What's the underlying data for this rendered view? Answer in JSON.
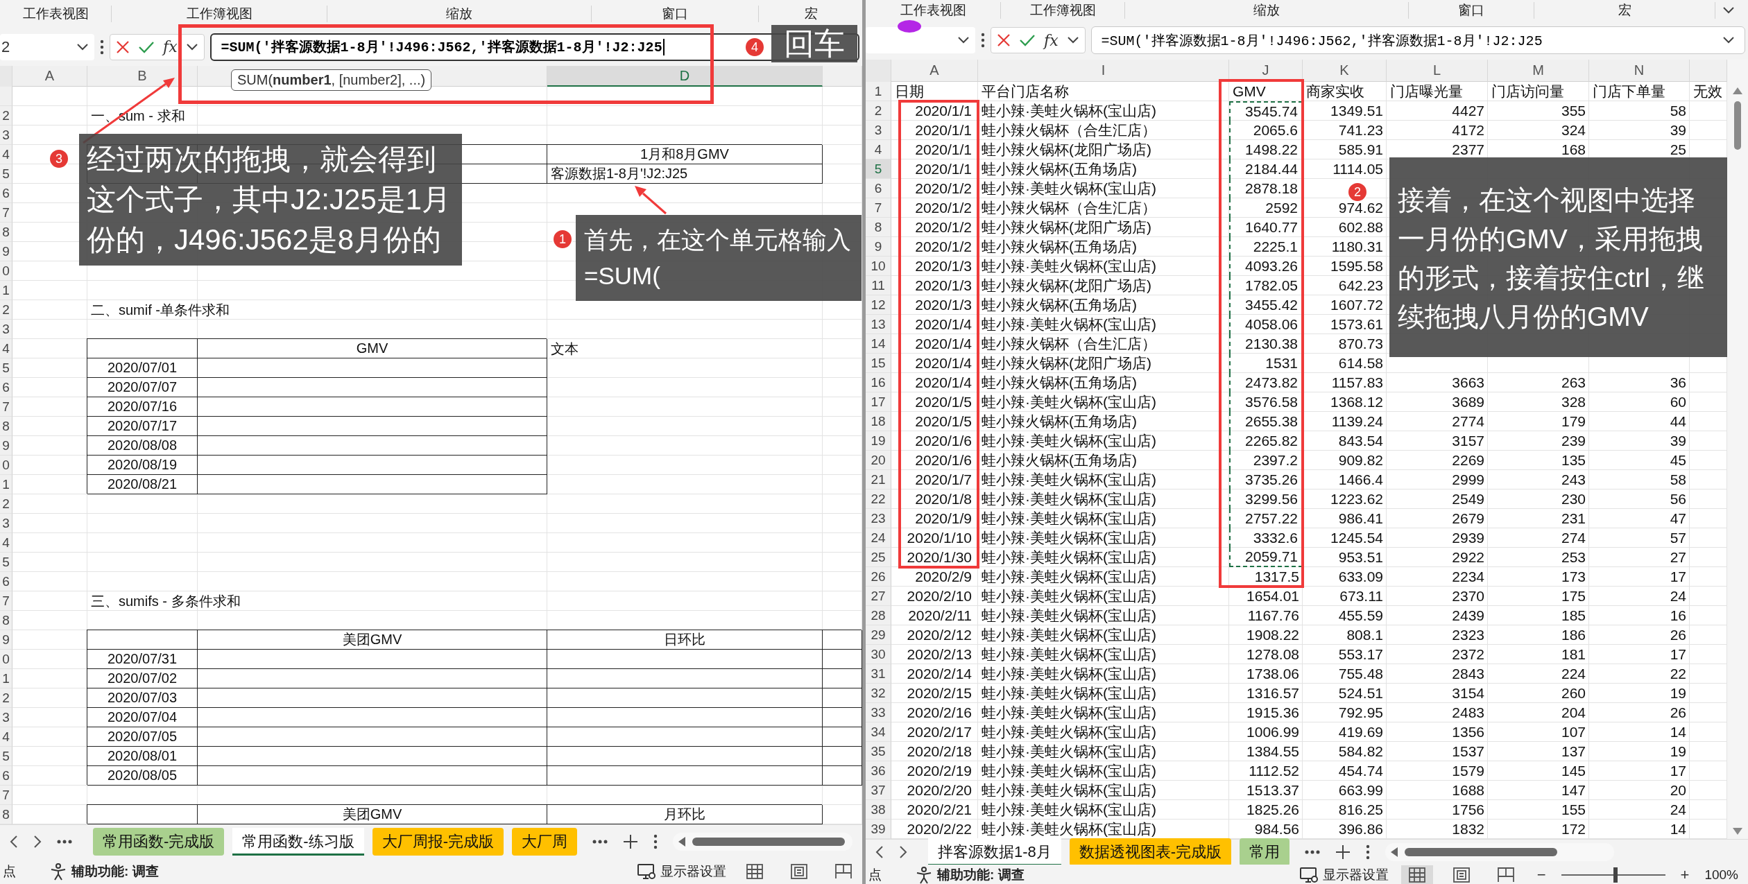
{
  "panes": [
    {
      "ribbon_tabs": [
        "工作表视图",
        "工作簿视图",
        "缩放",
        "窗口",
        "宏"
      ],
      "formula_bar": {
        "name_box": "2",
        "function_label": "fx",
        "formula": "=SUM('拌客源数据1-8月'!J496:J562,'拌客源数据1-8月'!J2:J25",
        "editing": true
      },
      "sheet": {
        "columns": [
          {
            "letter": "A",
            "selected": false
          },
          {
            "letter": "B",
            "selected": false
          },
          {
            "selected": false
          },
          {
            "letter": "D",
            "selected": true
          },
          {
            "selected": false
          }
        ],
        "rows": [
          {
            "number": "2",
            "cells": [
              {
                "kind": "empty"
              },
              {
                "kind": "title",
                "text": "一、sum - 求和"
              }
            ]
          },
          {
            "number": "3"
          },
          {
            "number": "4",
            "cells": [
              {
                "kind": "empty"
              },
              {
                "kind": "blank"
              },
              {
                "kind": "blank"
              },
              {
                "kind": "header",
                "text": "1月和8月GMV"
              }
            ]
          },
          {
            "number": "5",
            "cells": [
              {
                "kind": "empty"
              },
              {
                "kind": "blank"
              },
              {
                "kind": "blank"
              },
              {
                "kind": "edit",
                "text": "客源数据1-8月'!J2:J25"
              }
            ]
          },
          {
            "number": "6"
          },
          {
            "number": "7"
          },
          {
            "number": "8"
          },
          {
            "number": "9"
          },
          {
            "number": "0"
          },
          {
            "number": "1"
          },
          {
            "number": "2",
            "cells": [
              {
                "kind": "empty"
              },
              {
                "kind": "title",
                "text": "二、sumif -单条件求和"
              }
            ]
          },
          {
            "number": "3"
          },
          {
            "number": "4",
            "cells": [
              {
                "kind": "empty"
              },
              {
                "kind": "blank"
              },
              {
                "kind": "header",
                "text": "GMV"
              },
              {
                "kind": "note",
                "text": "文本"
              }
            ]
          },
          {
            "number": "5",
            "cells": [
              {
                "kind": "empty"
              },
              {
                "kind": "value",
                "text": "2020/07/01"
              },
              {
                "kind": "blank"
              }
            ]
          },
          {
            "number": "6",
            "cells": [
              {
                "kind": "empty"
              },
              {
                "kind": "value",
                "text": "2020/07/07"
              },
              {
                "kind": "blank"
              }
            ]
          },
          {
            "number": "7",
            "cells": [
              {
                "kind": "empty"
              },
              {
                "kind": "value",
                "text": "2020/07/16"
              },
              {
                "kind": "blank"
              }
            ]
          },
          {
            "number": "8",
            "cells": [
              {
                "kind": "empty"
              },
              {
                "kind": "value",
                "text": "2020/07/17"
              },
              {
                "kind": "blank"
              }
            ]
          },
          {
            "number": "9",
            "cells": [
              {
                "kind": "empty"
              },
              {
                "kind": "value",
                "text": "2020/08/08"
              },
              {
                "kind": "blank"
              }
            ]
          },
          {
            "number": "0",
            "cells": [
              {
                "kind": "empty"
              },
              {
                "kind": "value",
                "text": "2020/08/19"
              },
              {
                "kind": "blank"
              }
            ]
          },
          {
            "number": "1",
            "cells": [
              {
                "kind": "empty"
              },
              {
                "kind": "value",
                "text": "2020/08/21"
              },
              {
                "kind": "blank"
              }
            ]
          },
          {
            "number": "2"
          },
          {
            "number": "3"
          },
          {
            "number": "4"
          },
          {
            "number": "5"
          },
          {
            "number": "6"
          },
          {
            "number": "7",
            "cells": [
              {
                "kind": "empty"
              },
              {
                "kind": "title",
                "text": "三、sumifs - 多条件求和"
              }
            ]
          },
          {
            "number": "8"
          },
          {
            "number": "9",
            "cells": [
              {
                "kind": "empty"
              },
              {
                "kind": "blank"
              },
              {
                "kind": "header",
                "text": "美团GMV"
              },
              {
                "kind": "header",
                "text": "日环比"
              },
              {
                "kind": "blank"
              }
            ]
          },
          {
            "number": "0",
            "cells": [
              {
                "kind": "empty"
              },
              {
                "kind": "value",
                "text": "2020/07/31"
              },
              {
                "kind": "blank"
              },
              {
                "kind": "blank"
              },
              {
                "kind": "blank"
              }
            ]
          },
          {
            "number": "1",
            "cells": [
              {
                "kind": "empty"
              },
              {
                "kind": "value",
                "text": "2020/07/02"
              },
              {
                "kind": "blank"
              },
              {
                "kind": "blank"
              },
              {
                "kind": "blank"
              }
            ]
          },
          {
            "number": "2",
            "cells": [
              {
                "kind": "empty"
              },
              {
                "kind": "value",
                "text": "2020/07/03"
              },
              {
                "kind": "blank"
              },
              {
                "kind": "blank"
              },
              {
                "kind": "blank"
              }
            ]
          },
          {
            "number": "3",
            "cells": [
              {
                "kind": "empty"
              },
              {
                "kind": "value",
                "text": "2020/07/04"
              },
              {
                "kind": "blank"
              },
              {
                "kind": "blank"
              },
              {
                "kind": "blank"
              }
            ]
          },
          {
            "number": "4",
            "cells": [
              {
                "kind": "empty"
              },
              {
                "kind": "value",
                "text": "2020/07/05"
              },
              {
                "kind": "blank"
              },
              {
                "kind": "blank"
              },
              {
                "kind": "blank"
              }
            ]
          },
          {
            "number": "5",
            "cells": [
              {
                "kind": "empty"
              },
              {
                "kind": "value",
                "text": "2020/08/01"
              },
              {
                "kind": "blank"
              },
              {
                "kind": "blank"
              },
              {
                "kind": "blank"
              }
            ]
          },
          {
            "number": "6",
            "cells": [
              {
                "kind": "empty"
              },
              {
                "kind": "value",
                "text": "2020/08/05"
              },
              {
                "kind": "blank"
              },
              {
                "kind": "blank"
              },
              {
                "kind": "blank"
              }
            ]
          },
          {
            "number": "7"
          },
          {
            "number": "8",
            "cells": [
              {
                "kind": "empty"
              },
              {
                "kind": "blank"
              },
              {
                "kind": "header",
                "text": "美团GMV"
              },
              {
                "kind": "header",
                "text": "月环比"
              }
            ]
          }
        ]
      },
      "sheet_tabs": [
        {
          "label": "常用函数-完成版",
          "selected": false,
          "color": "#a9d08e"
        },
        {
          "label": "常用函数-练习版",
          "selected": true
        },
        {
          "label": "大厂周报-完成版",
          "selected": false,
          "color": "#ffc000"
        },
        {
          "label": "大厂周",
          "selected": false,
          "color": "#ffc000"
        }
      ],
      "status": {
        "mode": "点",
        "accessibility": "辅助功能: 调查",
        "display_settings": "显示器设置",
        "views": [
          {
            "kind": "normal",
            "selected": false
          },
          {
            "kind": "page",
            "selected": false
          },
          {
            "kind": "break",
            "selected": false
          }
        ]
      }
    },
    {
      "ribbon_tabs": [
        "工作表视图",
        "工作簿视图",
        "缩放",
        "窗口",
        "宏"
      ],
      "formula_bar": {
        "function_label": "fx",
        "formula": "=SUM('拌客源数据1-8月'!J496:J562,'拌客源数据1-8月'!J2:J25",
        "editing": false
      },
      "grid": {
        "columns": [
          {
            "letter": "A",
            "selected": false
          },
          {
            "letter": "I",
            "selected": false
          },
          {
            "letter": "J",
            "selected": false
          },
          {
            "letter": "K",
            "selected": false
          },
          {
            "letter": "L",
            "selected": false
          },
          {
            "letter": "M",
            "selected": false
          },
          {
            "letter": "N",
            "selected": false
          },
          {
            "selected": false
          }
        ],
        "rows": [
          {
            "kind": "header",
            "number": "1",
            "selected": false,
            "date": "日期",
            "store": "平台门店名称",
            "gmv": "GMV",
            "received": "商家实收",
            "exposure": "门店曝光量",
            "visits": "门店访问量",
            "orders": "门店下单量",
            "extra": "无效"
          },
          {
            "kind": "data",
            "number": "2",
            "selected": false,
            "gmv_marked": true,
            "date": "2020/1/1",
            "store": "蛙小辣·美蛙火锅杯(宝山店)",
            "gmv": "3545.74",
            "received": "1349.51",
            "exposure": "4427",
            "visits": "355",
            "orders": "58"
          },
          {
            "kind": "data",
            "number": "3",
            "selected": false,
            "gmv_marked": true,
            "date": "2020/1/1",
            "store": "蛙小辣火锅杯（合生汇店）",
            "gmv": "2065.6",
            "received": "741.23",
            "exposure": "4172",
            "visits": "324",
            "orders": "39"
          },
          {
            "kind": "data",
            "number": "4",
            "selected": false,
            "gmv_marked": true,
            "date": "2020/1/1",
            "store": "蛙小辣火锅杯(龙阳广场店)",
            "gmv": "1498.22",
            "received": "585.91",
            "exposure": "2377",
            "visits": "168",
            "orders": "25"
          },
          {
            "kind": "data",
            "number": "5",
            "selected": true,
            "gmv_marked": true,
            "date": "2020/1/1",
            "store": "蛙小辣火锅杯(五角场店)",
            "gmv": "2184.44",
            "received": "1114.05"
          },
          {
            "kind": "data",
            "number": "6",
            "selected": false,
            "gmv_marked": true,
            "date": "2020/1/2",
            "store": "蛙小辣·美蛙火锅杯(宝山店)",
            "gmv": "2878.18"
          },
          {
            "kind": "data",
            "number": "7",
            "selected": false,
            "gmv_marked": true,
            "date": "2020/1/2",
            "store": "蛙小辣火锅杯（合生汇店）",
            "gmv": "2592",
            "received": "974.62"
          },
          {
            "kind": "data",
            "number": "8",
            "selected": false,
            "gmv_marked": true,
            "date": "2020/1/2",
            "store": "蛙小辣火锅杯(龙阳广场店)",
            "gmv": "1640.77",
            "received": "602.88"
          },
          {
            "kind": "data",
            "number": "9",
            "selected": false,
            "gmv_marked": true,
            "date": "2020/1/2",
            "store": "蛙小辣火锅杯(五角场店)",
            "gmv": "2225.1",
            "received": "1180.31"
          },
          {
            "kind": "data",
            "number": "10",
            "selected": false,
            "gmv_marked": true,
            "date": "2020/1/3",
            "store": "蛙小辣·美蛙火锅杯(宝山店)",
            "gmv": "4093.26",
            "received": "1595.58"
          },
          {
            "kind": "data",
            "number": "11",
            "selected": false,
            "gmv_marked": true,
            "date": "2020/1/3",
            "store": "蛙小辣火锅杯(龙阳广场店)",
            "gmv": "1782.05",
            "received": "642.23"
          },
          {
            "kind": "data",
            "number": "12",
            "selected": false,
            "gmv_marked": true,
            "date": "2020/1/3",
            "store": "蛙小辣火锅杯(五角场店)",
            "gmv": "3455.42",
            "received": "1607.72"
          },
          {
            "kind": "data",
            "number": "13",
            "selected": false,
            "gmv_marked": true,
            "date": "2020/1/4",
            "store": "蛙小辣·美蛙火锅杯(宝山店)",
            "gmv": "4058.06",
            "received": "1573.61"
          },
          {
            "kind": "data",
            "number": "14",
            "selected": false,
            "gmv_marked": true,
            "date": "2020/1/4",
            "store": "蛙小辣火锅杯（合生汇店）",
            "gmv": "2130.38",
            "received": "870.73"
          },
          {
            "kind": "data",
            "number": "15",
            "selected": false,
            "gmv_marked": true,
            "date": "2020/1/4",
            "store": "蛙小辣火锅杯(龙阳广场店)",
            "gmv": "1531",
            "received": "614.58"
          },
          {
            "kind": "data",
            "number": "16",
            "selected": false,
            "gmv_marked": true,
            "date": "2020/1/4",
            "store": "蛙小辣火锅杯(五角场店)",
            "gmv": "2473.82",
            "received": "1157.83",
            "exposure": "3663",
            "visits": "263",
            "orders": "36"
          },
          {
            "kind": "data",
            "number": "17",
            "selected": false,
            "gmv_marked": true,
            "date": "2020/1/5",
            "store": "蛙小辣·美蛙火锅杯(宝山店)",
            "gmv": "3576.58",
            "received": "1368.12",
            "exposure": "3689",
            "visits": "328",
            "orders": "60"
          },
          {
            "kind": "data",
            "number": "18",
            "selected": false,
            "gmv_marked": true,
            "date": "2020/1/5",
            "store": "蛙小辣火锅杯(五角场店)",
            "gmv": "2655.38",
            "received": "1139.24",
            "exposure": "2774",
            "visits": "179",
            "orders": "44"
          },
          {
            "kind": "data",
            "number": "19",
            "selected": false,
            "gmv_marked": true,
            "date": "2020/1/6",
            "store": "蛙小辣·美蛙火锅杯(宝山店)",
            "gmv": "2265.82",
            "received": "843.54",
            "exposure": "3157",
            "visits": "239",
            "orders": "39"
          },
          {
            "kind": "data",
            "number": "20",
            "selected": false,
            "gmv_marked": true,
            "date": "2020/1/6",
            "store": "蛙小辣火锅杯(五角场店)",
            "gmv": "2397.2",
            "received": "909.82",
            "exposure": "2269",
            "visits": "135",
            "orders": "45"
          },
          {
            "kind": "data",
            "number": "21",
            "selected": false,
            "gmv_marked": true,
            "date": "2020/1/7",
            "store": "蛙小辣·美蛙火锅杯(宝山店)",
            "gmv": "3735.26",
            "received": "1466.4",
            "exposure": "2999",
            "visits": "243",
            "orders": "58"
          },
          {
            "kind": "data",
            "number": "22",
            "selected": false,
            "gmv_marked": true,
            "date": "2020/1/8",
            "store": "蛙小辣·美蛙火锅杯(宝山店)",
            "gmv": "3299.56",
            "received": "1223.62",
            "exposure": "2549",
            "visits": "230",
            "orders": "56"
          },
          {
            "kind": "data",
            "number": "23",
            "selected": false,
            "gmv_marked": true,
            "date": "2020/1/9",
            "store": "蛙小辣·美蛙火锅杯(宝山店)",
            "gmv": "2757.22",
            "received": "986.41",
            "exposure": "2679",
            "visits": "231",
            "orders": "47"
          },
          {
            "kind": "data",
            "number": "24",
            "selected": false,
            "gmv_marked": true,
            "date": "2020/1/10",
            "store": "蛙小辣·美蛙火锅杯(宝山店)",
            "gmv": "3332.6",
            "received": "1245.54",
            "exposure": "2939",
            "visits": "274",
            "orders": "57"
          },
          {
            "kind": "data",
            "number": "25",
            "selected": false,
            "gmv_marked": true,
            "date": "2020/1/30",
            "store": "蛙小辣·美蛙火锅杯(宝山店)",
            "gmv": "2059.71",
            "received": "953.51",
            "exposure": "2922",
            "visits": "253",
            "orders": "27"
          },
          {
            "kind": "data",
            "number": "26",
            "selected": false,
            "gmv_marked": false,
            "date": "2020/2/9",
            "store": "蛙小辣·美蛙火锅杯(宝山店)",
            "gmv": "1317.5",
            "received": "633.09",
            "exposure": "2234",
            "visits": "173",
            "orders": "17"
          },
          {
            "kind": "data",
            "number": "27",
            "selected": false,
            "gmv_marked": false,
            "date": "2020/2/10",
            "store": "蛙小辣·美蛙火锅杯(宝山店)",
            "gmv": "1654.01",
            "received": "673.11",
            "exposure": "2370",
            "visits": "175",
            "orders": "24"
          },
          {
            "kind": "data",
            "number": "28",
            "selected": false,
            "gmv_marked": false,
            "date": "2020/2/11",
            "store": "蛙小辣·美蛙火锅杯(宝山店)",
            "gmv": "1167.76",
            "received": "455.59",
            "exposure": "2439",
            "visits": "185",
            "orders": "16"
          },
          {
            "kind": "data",
            "number": "29",
            "selected": false,
            "gmv_marked": false,
            "date": "2020/2/12",
            "store": "蛙小辣·美蛙火锅杯(宝山店)",
            "gmv": "1908.22",
            "received": "808.1",
            "exposure": "2323",
            "visits": "186",
            "orders": "26"
          },
          {
            "kind": "data",
            "number": "30",
            "selected": false,
            "gmv_marked": false,
            "date": "2020/2/13",
            "store": "蛙小辣·美蛙火锅杯(宝山店)",
            "gmv": "1278.08",
            "received": "553.17",
            "exposure": "2372",
            "visits": "181",
            "orders": "17"
          },
          {
            "kind": "data",
            "number": "31",
            "selected": false,
            "gmv_marked": false,
            "date": "2020/2/14",
            "store": "蛙小辣·美蛙火锅杯(宝山店)",
            "gmv": "1738.06",
            "received": "755.48",
            "exposure": "2843",
            "visits": "224",
            "orders": "22"
          },
          {
            "kind": "data",
            "number": "32",
            "selected": false,
            "gmv_marked": false,
            "date": "2020/2/15",
            "store": "蛙小辣·美蛙火锅杯(宝山店)",
            "gmv": "1316.57",
            "received": "524.51",
            "exposure": "3154",
            "visits": "260",
            "orders": "19"
          },
          {
            "kind": "data",
            "number": "33",
            "selected": false,
            "gmv_marked": false,
            "date": "2020/2/16",
            "store": "蛙小辣·美蛙火锅杯(宝山店)",
            "gmv": "1915.36",
            "received": "792.95",
            "exposure": "2483",
            "visits": "204",
            "orders": "26"
          },
          {
            "kind": "data",
            "number": "34",
            "selected": false,
            "gmv_marked": false,
            "date": "2020/2/17",
            "store": "蛙小辣·美蛙火锅杯(宝山店)",
            "gmv": "1006.99",
            "received": "419.69",
            "exposure": "1356",
            "visits": "107",
            "orders": "14"
          },
          {
            "kind": "data",
            "number": "35",
            "selected": false,
            "gmv_marked": false,
            "date": "2020/2/18",
            "store": "蛙小辣·美蛙火锅杯(宝山店)",
            "gmv": "1384.55",
            "received": "584.82",
            "exposure": "1537",
            "visits": "137",
            "orders": "19"
          },
          {
            "kind": "data",
            "number": "36",
            "selected": false,
            "gmv_marked": false,
            "date": "2020/2/19",
            "store": "蛙小辣·美蛙火锅杯(宝山店)",
            "gmv": "1112.52",
            "received": "454.74",
            "exposure": "1579",
            "visits": "145",
            "orders": "17"
          },
          {
            "kind": "data",
            "number": "37",
            "selected": false,
            "gmv_marked": false,
            "date": "2020/2/20",
            "store": "蛙小辣·美蛙火锅杯(宝山店)",
            "gmv": "1513.37",
            "received": "663.99",
            "exposure": "1688",
            "visits": "147",
            "orders": "20"
          },
          {
            "kind": "data",
            "number": "38",
            "selected": false,
            "gmv_marked": false,
            "date": "2020/2/21",
            "store": "蛙小辣·美蛙火锅杯(宝山店)",
            "gmv": "1825.26",
            "received": "816.25",
            "exposure": "1756",
            "visits": "155",
            "orders": "24"
          },
          {
            "kind": "data",
            "number": "39",
            "selected": false,
            "gmv_marked": false,
            "date": "2020/2/22",
            "store": "蛙小辣·美蛙火锅杯(宝山店)",
            "gmv": "984.56",
            "received": "396.86",
            "exposure": "1832",
            "visits": "172",
            "orders": "14"
          }
        ]
      },
      "sheet_tabs": [
        {
          "label": "拌客源数据1-8月",
          "selected": true
        },
        {
          "label": "数据透视图表-完成版",
          "selected": false,
          "color": "#ffc000"
        },
        {
          "label": "常用",
          "selected": false,
          "color": "#a9d08e"
        }
      ],
      "status": {
        "mode": "点",
        "accessibility": "辅助功能: 调查",
        "display_settings": "显示器设置",
        "views": [
          {
            "kind": "normal",
            "selected": true
          },
          {
            "kind": "page",
            "selected": false
          },
          {
            "kind": "break",
            "selected": false
          }
        ],
        "zoom": {
          "minus": "−",
          "plus": "+",
          "level": 0.52,
          "value": "100%"
        }
      }
    }
  ],
  "tooltip": "SUM(**number1**, [number2], ...)",
  "callouts": [
    {
      "number": "1",
      "text": "首先，在这个单元格输入=SUM("
    },
    {
      "number": "2",
      "text": "接着，在这个视图中选择一月份的GMV，采用拖拽的形式，接着按住ctrl，继续拖拽八月份的GMV"
    },
    {
      "number": "3",
      "text": "经过两次的拖拽，就会得到这个式子，其中J2:J25是1月份的，J496:J562是8月份的"
    },
    {
      "number": "4",
      "text": "回车"
    }
  ]
}
